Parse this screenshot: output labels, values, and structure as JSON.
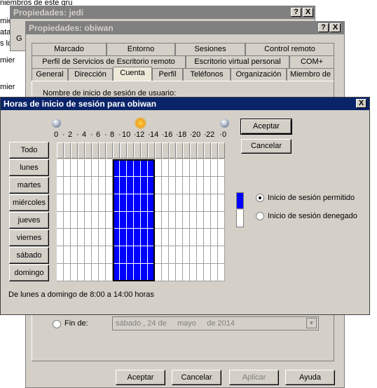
{
  "bg_window": {
    "lines": [
      "niembros de este gru",
      "mier",
      "ata",
      "s lo",
      "mier",
      "mier"
    ]
  },
  "win_jedi": {
    "title": "Propiedades: jedi",
    "help": "?",
    "close": "X",
    "snip": "G"
  },
  "win_obiwan": {
    "title": "Propiedades: obiwan",
    "help": "?",
    "close": "X",
    "tabs_row1": [
      "Marcado",
      "Entorno",
      "Sesiones",
      "Control remoto"
    ],
    "tabs_row2": [
      "Perfil de Servicios de Escritorio remoto",
      "Escritorio virtual personal",
      "COM+"
    ],
    "tabs_row3": [
      "General",
      "Dirección",
      "Cuenta",
      "Perfil",
      "Teléfonos",
      "Organización",
      "Miembro de"
    ],
    "selected_tab": "Cuenta",
    "field_label": "Nombre de inicio de sesión de usuario:",
    "end_label": "Fin de:",
    "end_date": {
      "weekday": "sábado",
      "day": ", 24 de",
      "month": "mayo",
      "year": "de 2014"
    },
    "buttons": {
      "ok": "Aceptar",
      "cancel": "Cancelar",
      "apply": "Aplicar",
      "help": "Ayuda"
    }
  },
  "dialog": {
    "title": "Horas de inicio de sesión para obiwan",
    "close": "X",
    "hours": [
      "0",
      "2",
      "4",
      "6",
      "8",
      "10",
      "12",
      "14",
      "16",
      "18",
      "20",
      "22",
      "0"
    ],
    "all_label": "Todo",
    "days": [
      "lunes",
      "martes",
      "miércoles",
      "jueves",
      "viernes",
      "sábado",
      "domingo"
    ],
    "permitted_from_hour": 8,
    "permitted_to_hour": 14,
    "summary": "De lunes a domingo de 8:00 a 14:00 horas",
    "ok": "Aceptar",
    "cancel": "Cancelar",
    "legend_allowed": "Inicio de sesión permitido",
    "legend_denied": "Inicio de sesión denegado",
    "colors": {
      "allowed": "#0000ff",
      "grid": "#a0a0a0",
      "selection": "#000000"
    }
  }
}
